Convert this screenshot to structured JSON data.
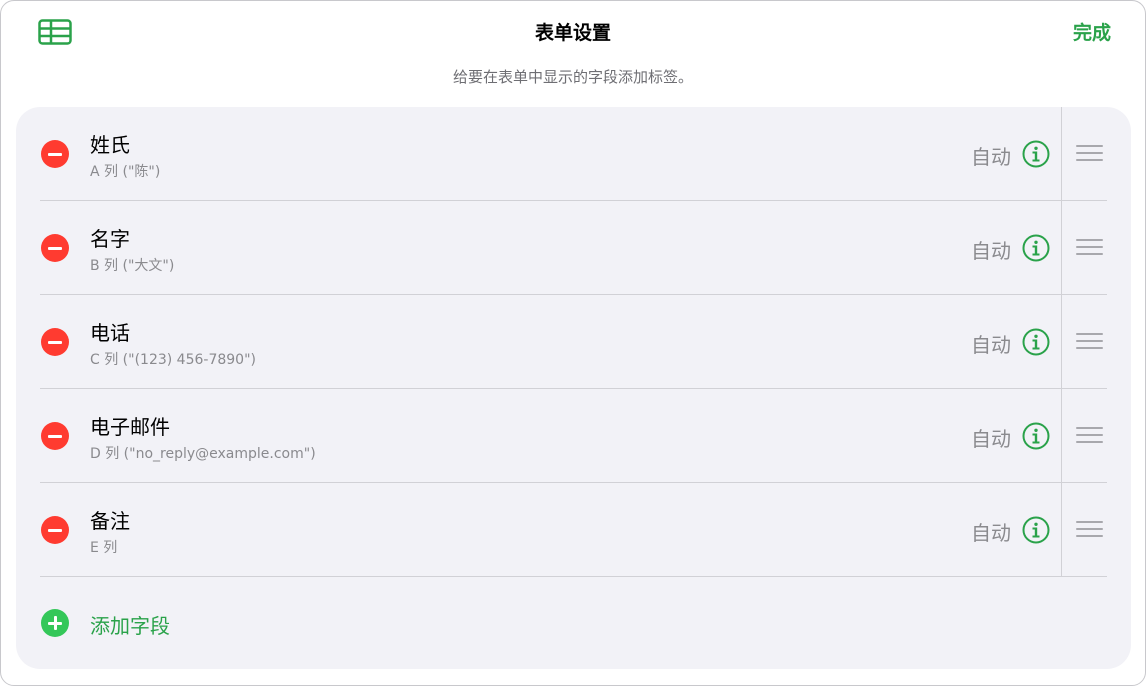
{
  "header": {
    "title": "表单设置",
    "done_label": "完成",
    "subtitle": "给要在表单中显示的字段添加标签。"
  },
  "colors": {
    "accent": "#2aa24a",
    "remove": "#ff3b30",
    "add": "#34c759",
    "panel_bg": "#f2f2f7"
  },
  "icons": {
    "table": "table-icon",
    "remove": "minus-circle-icon",
    "info": "info-circle-icon",
    "drag": "drag-handle-icon",
    "add": "plus-circle-icon"
  },
  "fields": [
    {
      "label": "姓氏",
      "source": "A 列 (\"陈\")",
      "type": "自动"
    },
    {
      "label": "名字",
      "source": "B 列 (\"大文\")",
      "type": "自动"
    },
    {
      "label": "电话",
      "source": "C 列 (\"(123) 456-7890\")",
      "type": "自动"
    },
    {
      "label": "电子邮件",
      "source": "D 列 (\"no_reply@example.com\")",
      "type": "自动"
    },
    {
      "label": "备注",
      "source": "E 列",
      "type": "自动"
    }
  ],
  "add_field_label": "添加字段"
}
